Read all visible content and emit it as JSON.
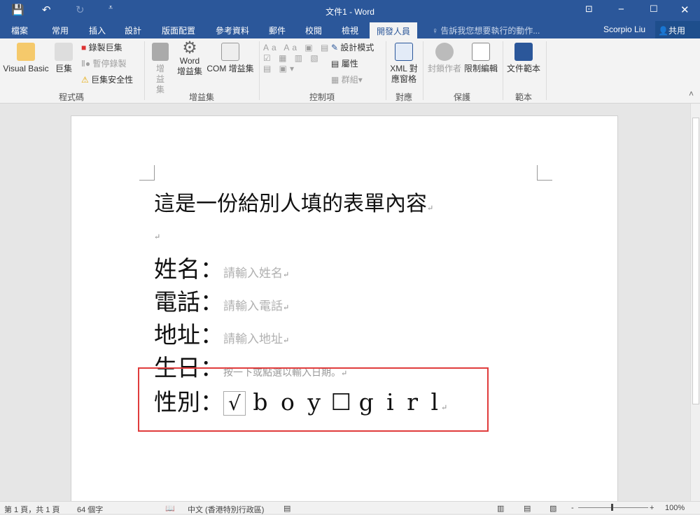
{
  "window": {
    "title": "文件1 - Word",
    "minimize": "−",
    "maximize": "☐",
    "close": "✕",
    "ribbon_display": "⊡"
  },
  "quick_access": {
    "save": "💾",
    "undo": "↶",
    "redo": "↻",
    "customize": "⩡"
  },
  "tabs": [
    "檔案",
    "常用",
    "插入",
    "設計",
    "版面配置",
    "參考資料",
    "郵件",
    "校閱",
    "檢視",
    "開發人員"
  ],
  "active_tab": "開發人員",
  "tell_me": "告訴我您想要執行的動作...",
  "user": "Scorpio Liu",
  "share": "共用",
  "ribbon": {
    "code": {
      "label": "程式碼",
      "visual_basic": "Visual Basic",
      "macros": "巨集",
      "record": "錄製巨集",
      "pause": "暫停錄製",
      "security": "巨集安全性"
    },
    "addins": {
      "label": "增益集",
      "addins": "增益集",
      "word_addins": "Word 增益集",
      "com_addins": "COM 增益集"
    },
    "controls": {
      "label": "控制項",
      "design_mode": "設計模式",
      "properties": "屬性",
      "group": "群組"
    },
    "mapping": {
      "label": "對應",
      "xml_pane": "XML 對應窗格"
    },
    "protect": {
      "label": "保護",
      "block_authors": "封鎖作者",
      "restrict": "限制編輯"
    },
    "templates": {
      "label": "範本",
      "doc_template": "文件範本"
    }
  },
  "document": {
    "heading": "這是一份給別人填的表單內容",
    "para_mark": "↵",
    "fields": [
      {
        "label": "姓名：",
        "placeholder": "請輸入姓名"
      },
      {
        "label": "電話：",
        "placeholder": "請輸入電話"
      },
      {
        "label": "地址：",
        "placeholder": "請輸入地址"
      },
      {
        "label": "生日：",
        "placeholder": "按一下或點選以輸入日期。"
      }
    ],
    "gender": {
      "label": "性別：",
      "checked_box": "√",
      "option1": "b o y",
      "unchecked_box": "☐",
      "option2": "g i r l"
    }
  },
  "status": {
    "page": "第 1 頁，共 1 頁",
    "words": "64 個字",
    "language": "中文 (香港特別行政區)",
    "zoom": "100%",
    "zoom_minus": "-",
    "zoom_plus": "+"
  }
}
